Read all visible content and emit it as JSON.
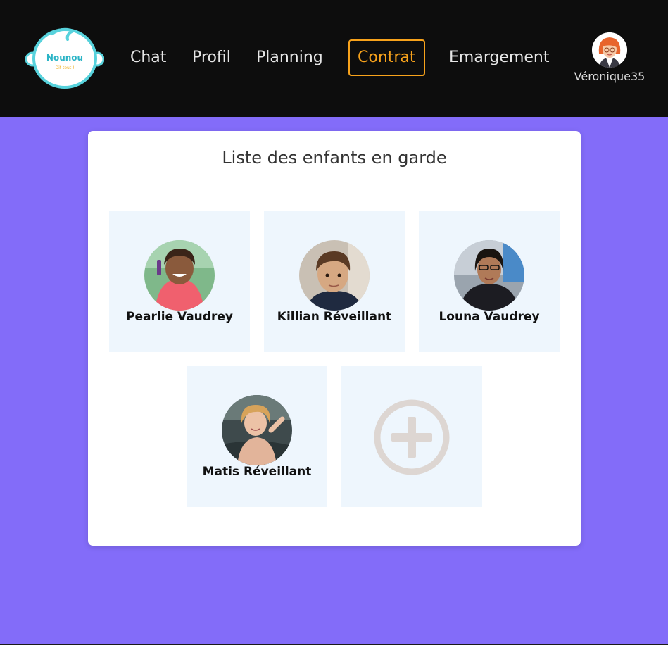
{
  "app": {
    "logo_text": "Nounou",
    "logo_subtext": "Dit tout !"
  },
  "nav": {
    "items": [
      {
        "label": "Chat"
      },
      {
        "label": "Profil"
      },
      {
        "label": "Planning"
      },
      {
        "label": "Contrat",
        "active": true
      },
      {
        "label": "Emargement"
      }
    ]
  },
  "user": {
    "name": "Véronique35",
    "avatar_icon": "user-avatar-icon"
  },
  "main": {
    "title": "Liste des enfants en garde",
    "children": [
      {
        "name": "Pearlie Vaudrey"
      },
      {
        "name": "Killian Réveillant"
      },
      {
        "name": "Louna Vaudrey"
      },
      {
        "name": "Matis Réveillant"
      }
    ],
    "add_icon": "plus-circle-icon"
  },
  "colors": {
    "background": "#836cf9",
    "navbar": "#0d0d0d",
    "active_nav": "#f7a21b",
    "tile": "#eef6fd",
    "add_icon": "#ddd6d2"
  }
}
